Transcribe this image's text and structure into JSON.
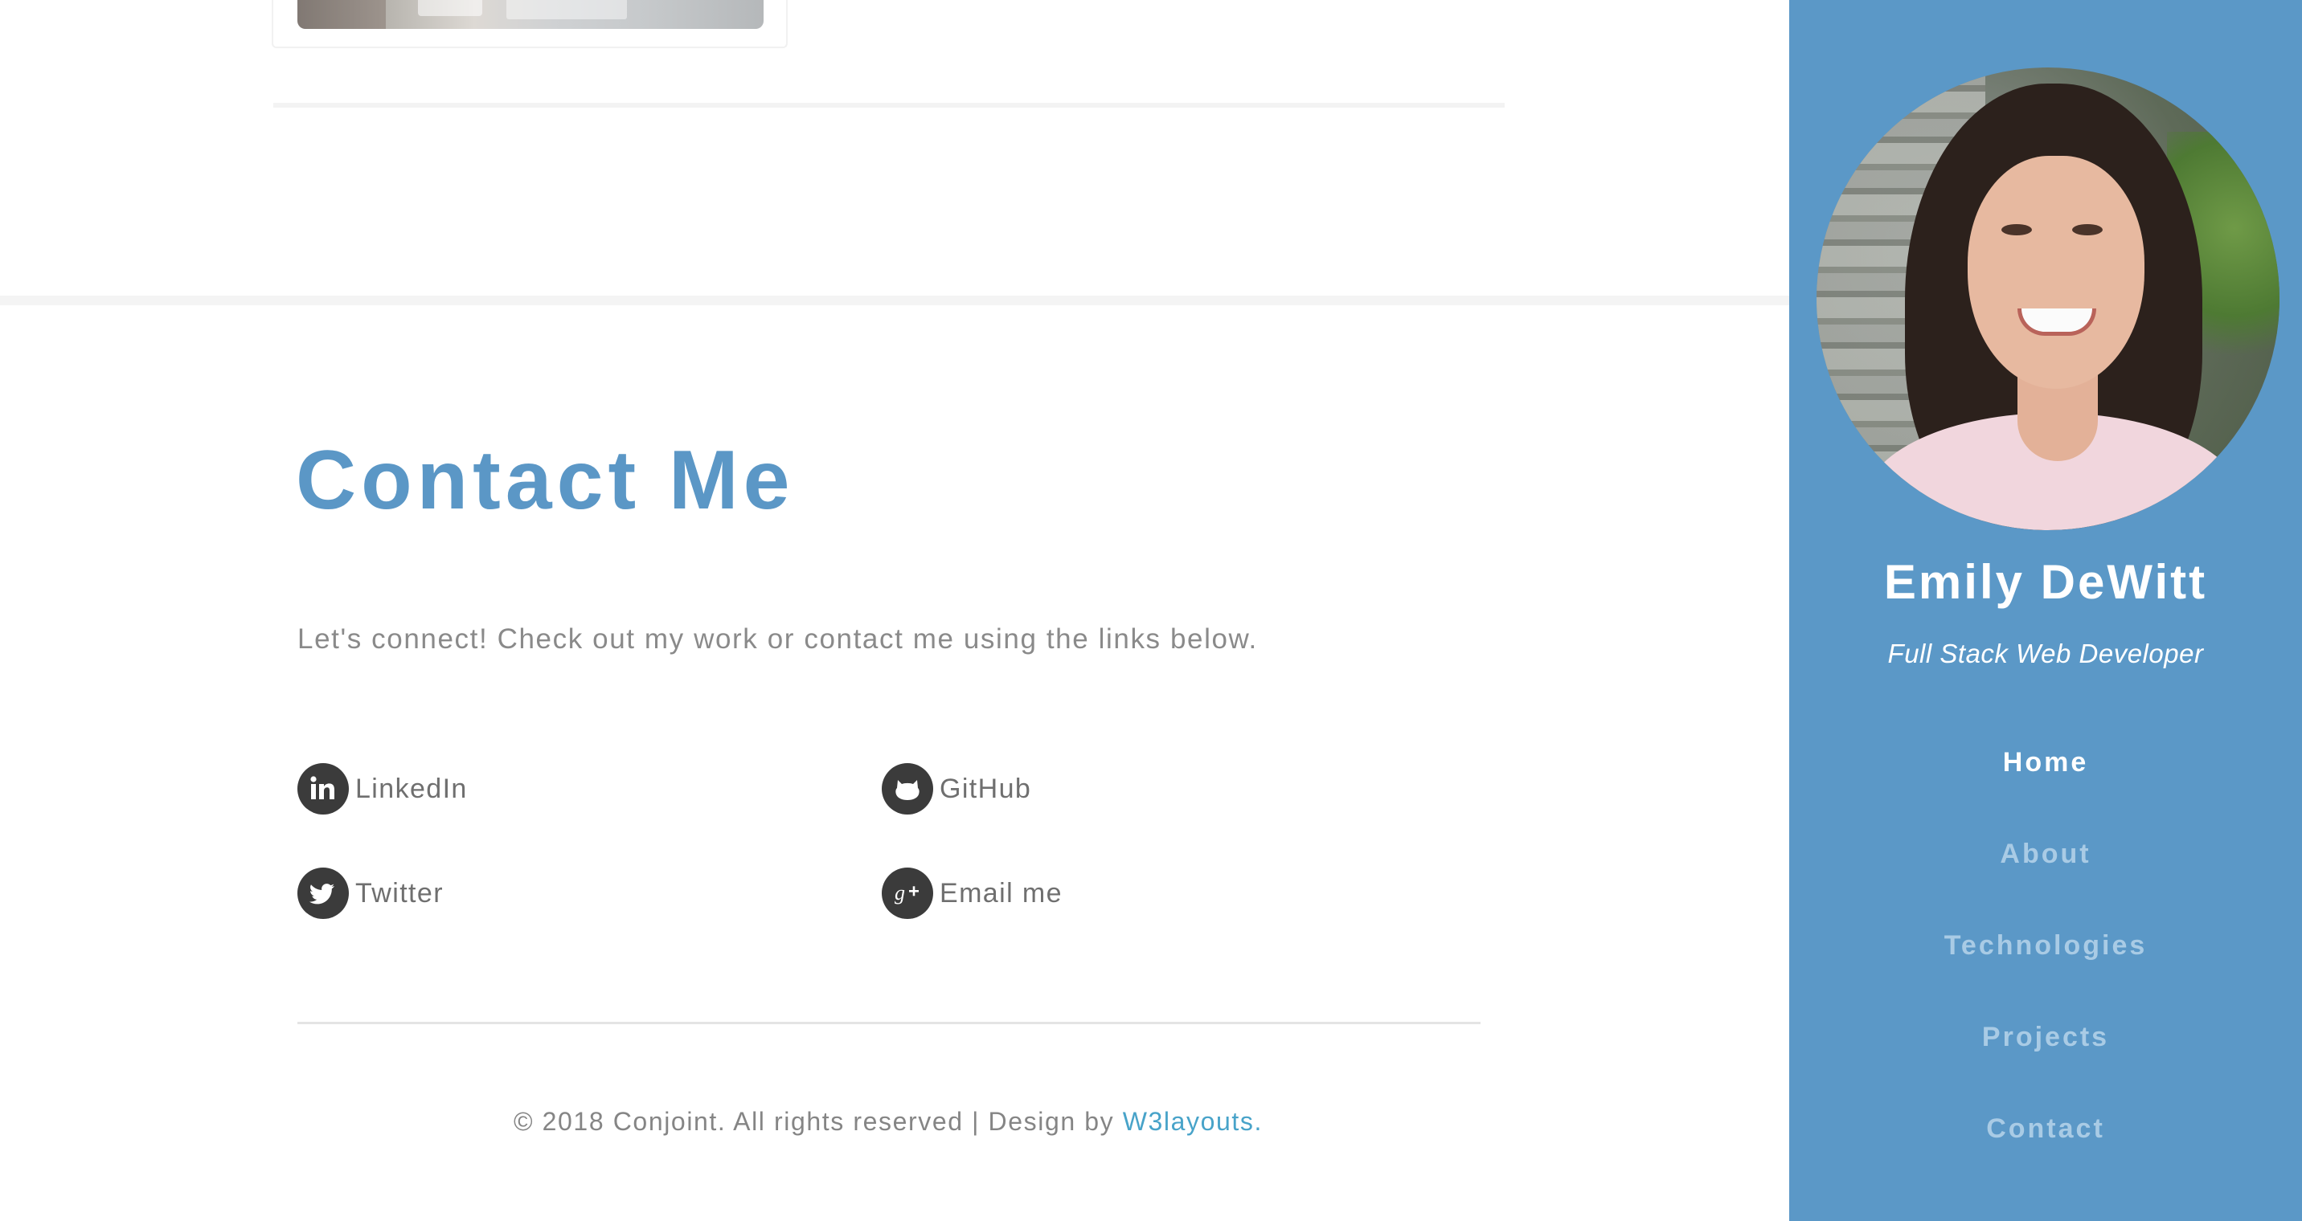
{
  "contact": {
    "title": "Contact Me",
    "intro": "Let's connect! Check out my work or contact me using the links below.",
    "links": [
      {
        "label": "LinkedIn",
        "icon": "linkedin-icon"
      },
      {
        "label": "GitHub",
        "icon": "github-icon"
      },
      {
        "label": "Twitter",
        "icon": "twitter-icon"
      },
      {
        "label": "Email me",
        "icon": "google-plus-icon"
      }
    ]
  },
  "footer": {
    "text": "© 2018 Conjoint. All rights reserved | Design by ",
    "link_label": "W3layouts",
    "suffix": "."
  },
  "sidebar": {
    "name": "Emily DeWitt",
    "role": "Full Stack Web Developer",
    "nav": [
      {
        "label": "Home",
        "active": true
      },
      {
        "label": "About",
        "active": false
      },
      {
        "label": "Technologies",
        "active": false
      },
      {
        "label": "Projects",
        "active": false
      },
      {
        "label": "Contact",
        "active": false
      }
    ]
  },
  "colors": {
    "accent": "#5b97c6",
    "sidebar_bg": "#5b98c7",
    "icon_circle": "#3b3b3b",
    "footer_link": "#48a3c9",
    "nav_inactive": "#a9cbe5"
  }
}
